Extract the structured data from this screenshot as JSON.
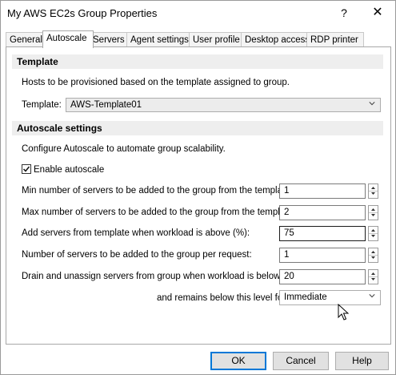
{
  "window": {
    "title": "My AWS EC2s Group Properties",
    "help_glyph": "?",
    "close_glyph": "✕"
  },
  "tabs": [
    {
      "label": "General"
    },
    {
      "label": "Autoscale"
    },
    {
      "label": "Servers"
    },
    {
      "label": "Agent settings"
    },
    {
      "label": "User profile"
    },
    {
      "label": "Desktop access"
    },
    {
      "label": "RDP printer"
    }
  ],
  "active_tab": "Autoscale",
  "template_section": {
    "header": "Template",
    "description": "Hosts to be provisioned based on the template assigned to group.",
    "template_label": "Template:",
    "template_value": "AWS-Template01"
  },
  "autoscale_section": {
    "header": "Autoscale settings",
    "description": "Configure Autoscale to automate group scalability.",
    "enable_label": "Enable autoscale",
    "enable_checked": true,
    "rows": [
      {
        "label": "Min number of servers to be added to the group from the template:",
        "value": "1"
      },
      {
        "label": "Max number of servers to be added to the group from the template:",
        "value": "2"
      },
      {
        "label": "Add servers from template when workload is above (%):",
        "value": "75"
      },
      {
        "label": "Number of servers to be added to the group per request:",
        "value": "1"
      },
      {
        "label": "Drain and unassign servers from group when workload is below (%):",
        "value": "20"
      }
    ],
    "remains_label": "and remains below this level for",
    "remains_value": "Immediate"
  },
  "buttons": {
    "ok": "OK",
    "cancel": "Cancel",
    "help": "Help"
  },
  "icons": {
    "checkbox": "check-icon",
    "dropdown": "chevron-down-icon",
    "spin_up": "arrow-up-icon",
    "spin_down": "arrow-down-icon",
    "cursor": "mouse-pointer-icon"
  },
  "colors": {
    "accent": "#0078d7",
    "section_bg": "#eeeeee"
  }
}
